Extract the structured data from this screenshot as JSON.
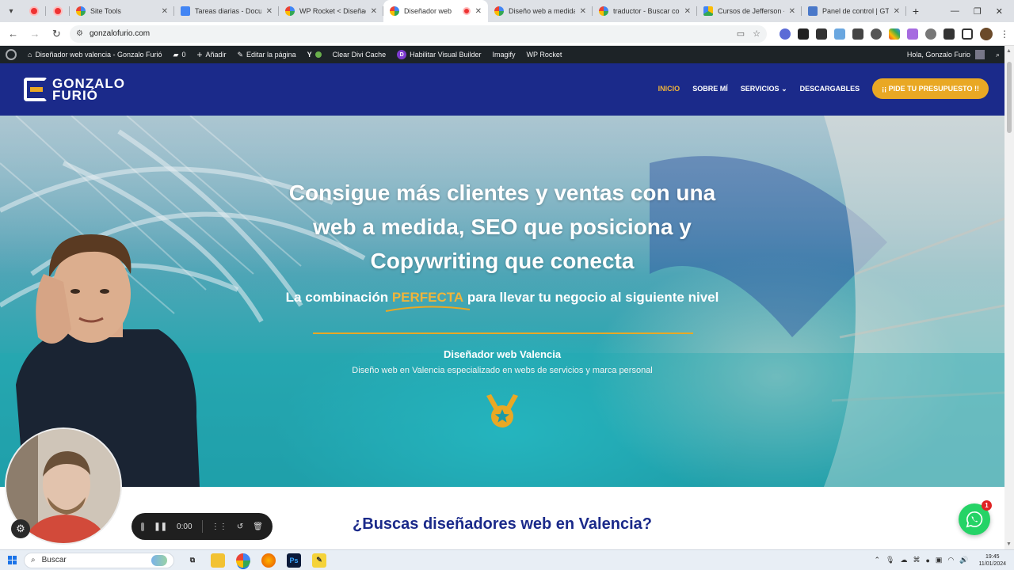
{
  "browser": {
    "tabs": [
      {
        "title": "",
        "icon": "record-icon",
        "pinned": true
      },
      {
        "title": "",
        "icon": "record-icon",
        "pinned": true
      },
      {
        "title": "Site Tools",
        "icon": "google-icon"
      },
      {
        "title": "Tareas diarias - Docum",
        "icon": "docs-icon"
      },
      {
        "title": "WP Rocket < Diseñado",
        "icon": "google-icon"
      },
      {
        "title": "Diseñador web",
        "icon": "google-icon",
        "active": true
      },
      {
        "title": "Diseño web a medida",
        "icon": "google-icon"
      },
      {
        "title": "traductor - Buscar con",
        "icon": "google-icon"
      },
      {
        "title": "Cursos de Jefferson - G",
        "icon": "drive-icon"
      },
      {
        "title": "Panel de control | GTm",
        "icon": "panel-icon"
      }
    ],
    "url": "gonzalofurio.com"
  },
  "wp_admin_bar": {
    "site_name": "Diseñador web valencia - Gonzalo Furió",
    "comments": "0",
    "add": "Añadir",
    "edit": "Editar la página",
    "clear_cache": "Clear Divi Cache",
    "visual_builder": "Habilitar Visual Builder",
    "imagify": "Imagify",
    "wp_rocket": "WP Rocket",
    "greeting": "Hola, Gonzalo Furio"
  },
  "site": {
    "logo_line1": "GONZALO",
    "logo_line2": "FURIÓ",
    "nav": [
      {
        "label": "INICIO",
        "active": true
      },
      {
        "label": "SOBRE MÍ"
      },
      {
        "label": "SERVICIOS",
        "dropdown": true
      },
      {
        "label": "DESCARGABLES"
      }
    ],
    "cta": "¡¡ PIDE TU PRESUPUESTO !!"
  },
  "hero": {
    "title_line1": "Consigue más clientes y ventas con una",
    "title_line2": "web a medida, SEO que posiciona y",
    "title_line3": "Copywriting que conecta",
    "sub_before": "La combinación ",
    "sub_highlight": "PERFECTA",
    "sub_after": " para llevar tu negocio al siguiente nivel",
    "heading": "Diseñador web Valencia",
    "description": "Diseño web en Valencia especializado en webs de servicios y marca personal"
  },
  "section2": {
    "title": "¿Buscas diseñadores web en Valencia?"
  },
  "recorder": {
    "time": "0:00"
  },
  "whatsapp": {
    "badge": "1"
  },
  "taskbar": {
    "search": "Buscar",
    "time": "19:45",
    "date": "11/01/2024"
  },
  "colors": {
    "brand_blue": "#1b2a8a",
    "accent_gold": "#e9a824",
    "whatsapp": "#25d366"
  }
}
